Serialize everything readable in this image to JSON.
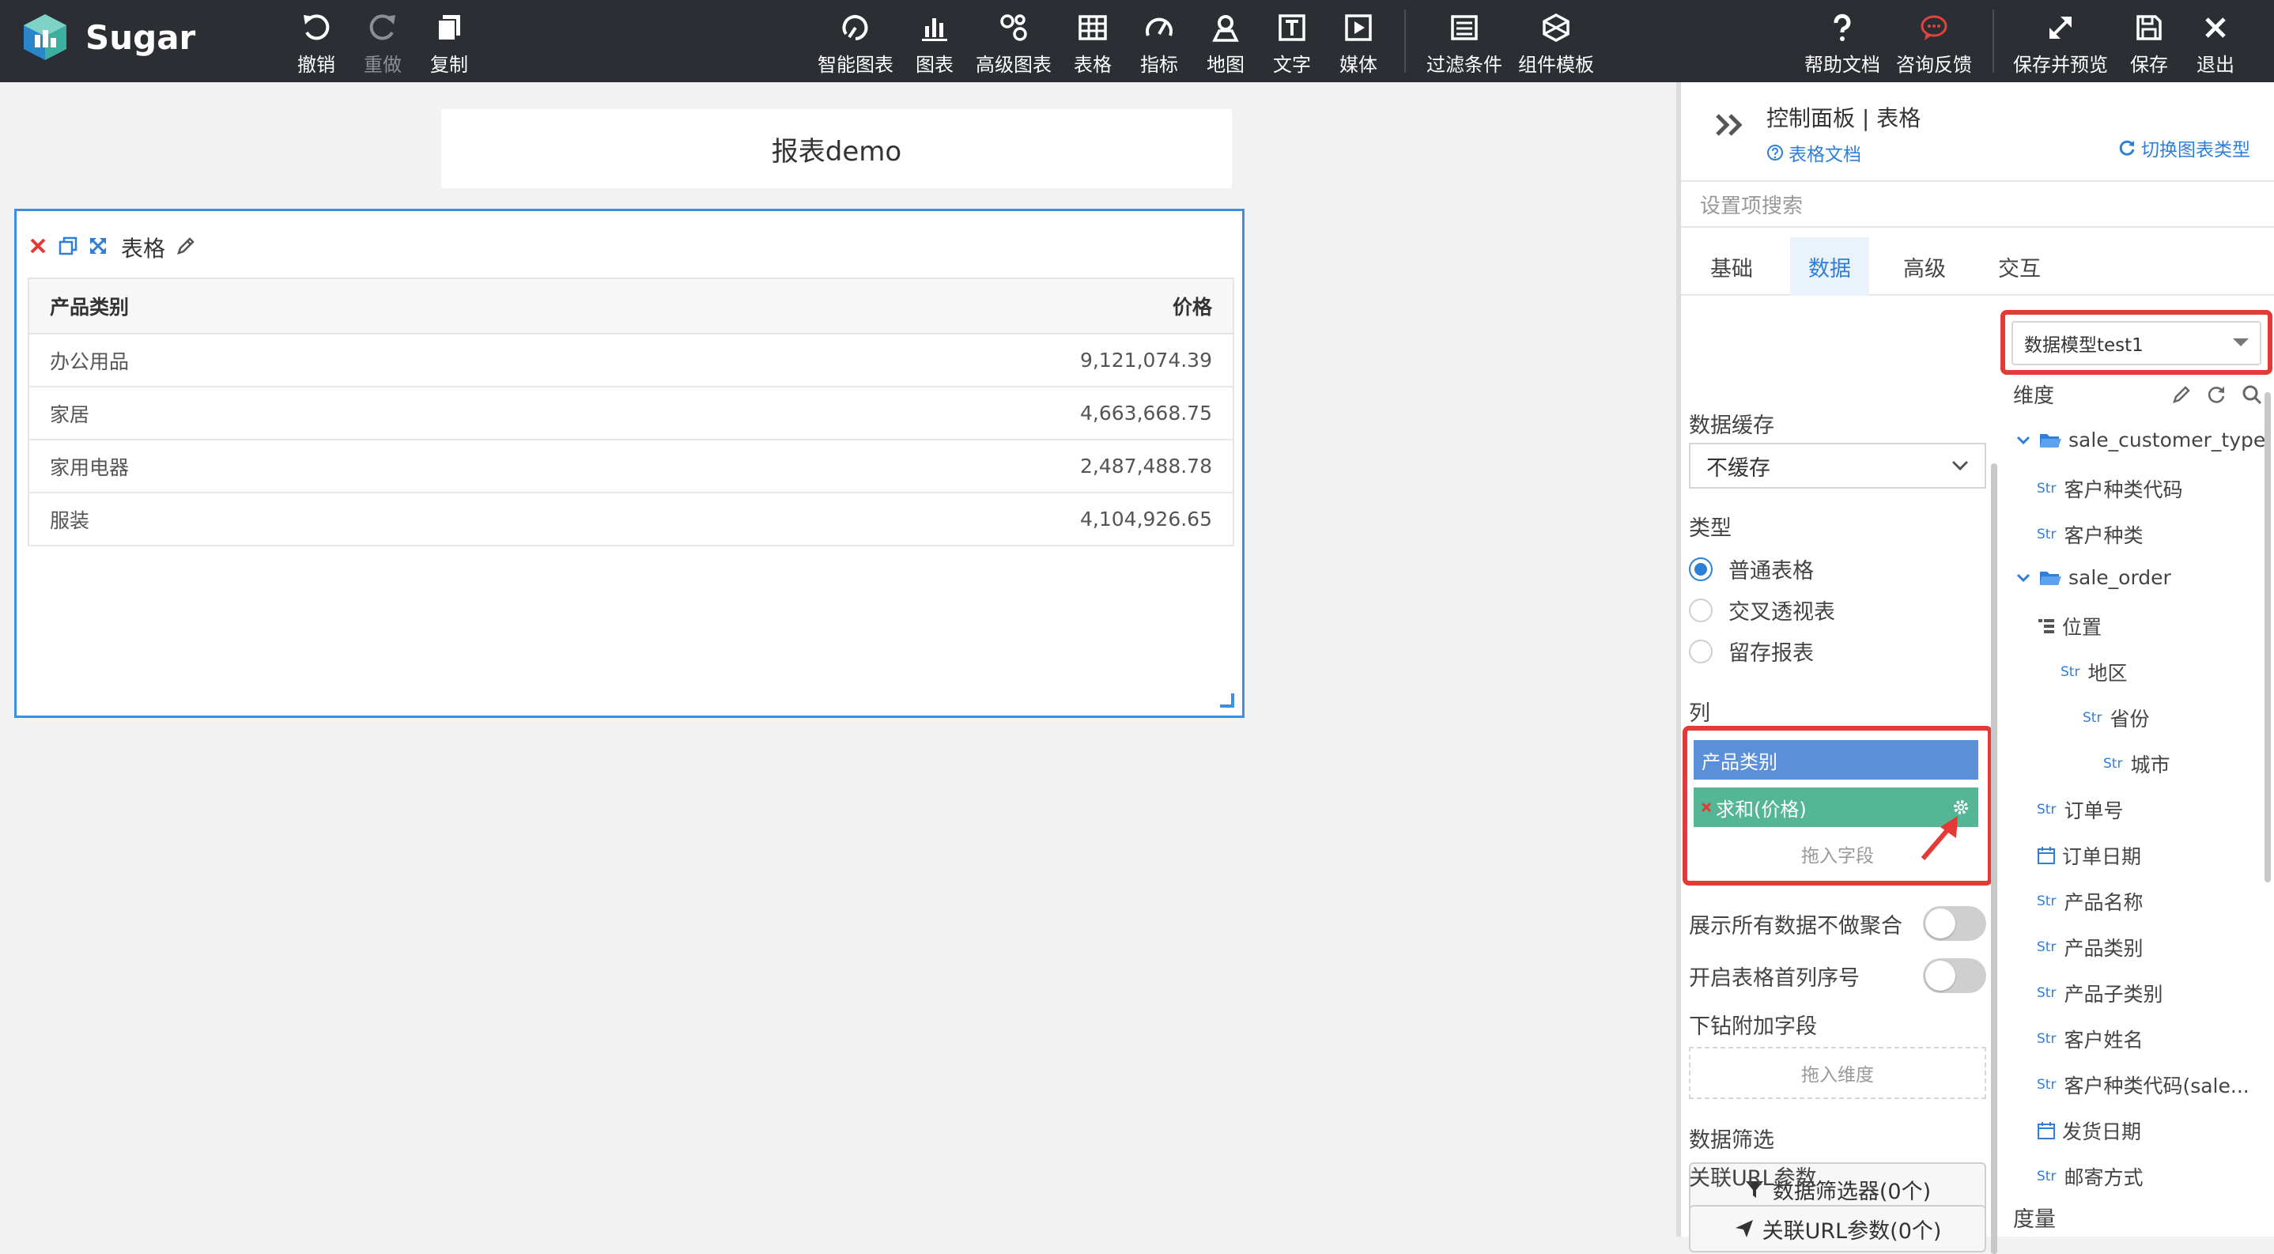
{
  "app": {
    "name": "Sugar"
  },
  "toolbar": {
    "undo": "撤销",
    "redo": "重做",
    "copy": "复制",
    "smart_chart": "智能图表",
    "chart": "图表",
    "advanced_chart": "高级图表",
    "table": "表格",
    "metric": "指标",
    "map": "地图",
    "text": "文字",
    "media": "媒体",
    "filter": "过滤条件",
    "component_template": "组件模板",
    "help_doc": "帮助文档",
    "feedback": "咨询反馈",
    "save_preview": "保存并预览",
    "save": "保存",
    "exit": "退出"
  },
  "report": {
    "title": "报表demo"
  },
  "widget": {
    "title": "表格",
    "columns": [
      "产品类别",
      "价格"
    ],
    "rows": [
      [
        "办公用品",
        "9,121,074.39"
      ],
      [
        "家居",
        "4,663,668.75"
      ],
      [
        "家用电器",
        "2,487,488.78"
      ],
      [
        "服装",
        "4,104,926.65"
      ]
    ]
  },
  "panel": {
    "title": "控制面板 | 表格",
    "doc_link": "表格文档",
    "switch_type": "切换图表类型",
    "search_placeholder": "设置项搜索",
    "tabs": [
      "基础",
      "数据",
      "高级",
      "交互"
    ],
    "active_tab": 1,
    "data_cache_label": "数据缓存",
    "data_cache_value": "不缓存",
    "type_label": "类型",
    "types": [
      "普通表格",
      "交叉透视表",
      "留存报表"
    ],
    "columns_label": "列",
    "column_fields": [
      "产品类别",
      "求和(价格)"
    ],
    "drop_field": "拖入字段",
    "show_all_label": "展示所有数据不做聚合",
    "row_number_label": "开启表格首列序号",
    "drill_label": "下钻附加字段",
    "drop_dimension": "拖入维度",
    "filter_label": "数据筛选",
    "filter_button": "数据筛选器(0个)",
    "url_label": "关联URL参数",
    "url_button": "关联URL参数(0个)",
    "model": "数据模型test1",
    "dimension_label": "维度",
    "measure_label": "度量",
    "tree": [
      {
        "text": "sale_customer_type",
        "kind": "folder",
        "level": 0
      },
      {
        "text": "客户种类代码",
        "kind": "str",
        "level": 1
      },
      {
        "text": "客户种类",
        "kind": "str",
        "level": 1
      },
      {
        "text": "sale_order",
        "kind": "folder",
        "level": 0
      },
      {
        "text": "位置",
        "kind": "hier",
        "level": 1
      },
      {
        "text": "地区",
        "kind": "str",
        "level": 2
      },
      {
        "text": "省份",
        "kind": "str",
        "level": 3
      },
      {
        "text": "城市",
        "kind": "str",
        "level": 4
      },
      {
        "text": "订单号",
        "kind": "str",
        "level": 1
      },
      {
        "text": "订单日期",
        "kind": "date",
        "level": 1
      },
      {
        "text": "产品名称",
        "kind": "str",
        "level": 1
      },
      {
        "text": "产品类别",
        "kind": "str",
        "level": 1
      },
      {
        "text": "产品子类别",
        "kind": "str",
        "level": 1
      },
      {
        "text": "客户姓名",
        "kind": "str",
        "level": 1
      },
      {
        "text": "客户种类代码(sale...",
        "kind": "str",
        "level": 1
      },
      {
        "text": "发货日期",
        "kind": "date",
        "level": 1
      },
      {
        "text": "邮寄方式",
        "kind": "str",
        "level": 1
      }
    ],
    "str_tag": "Str"
  },
  "colors": {
    "accent": "#2f7fd9",
    "highlight": "#e53935",
    "dim_field": "#5b8fd8",
    "measure_field": "#55b695"
  }
}
